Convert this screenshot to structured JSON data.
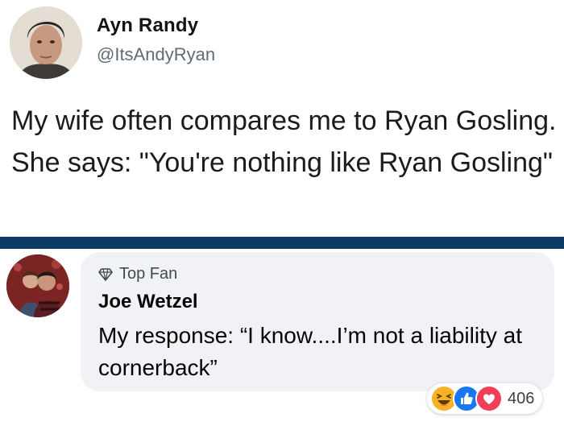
{
  "tweet": {
    "display_name": "Ayn Randy",
    "handle": "@ItsAndyRyan",
    "text": "My wife often compares me to Ryan Gosling. She says: \"You're nothing like Ryan Gosling\""
  },
  "comment": {
    "badge_label": "Top Fan",
    "commenter_name": "Joe Wetzel",
    "text": "My response: “I know....I’m not a liability at cornerback”",
    "reactions": {
      "icons": [
        "laugh-reaction-icon",
        "like-reaction-icon",
        "love-reaction-icon"
      ],
      "count": "406"
    }
  },
  "colors": {
    "divider": "#0e3a66",
    "bubble": "#f0f2f5",
    "like": "#1877f2",
    "love": "#f33e58",
    "laugh": "#f7b125"
  }
}
